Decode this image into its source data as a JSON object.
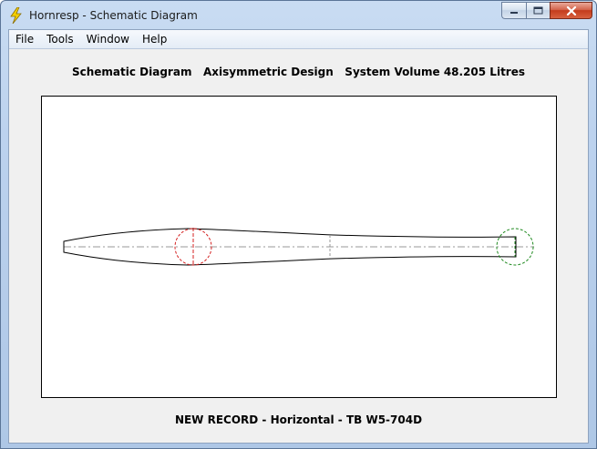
{
  "window": {
    "title": "Hornresp - Schematic Diagram",
    "icon": "lightning-bolt-icon",
    "controls": [
      "minimize-icon",
      "maximize-icon",
      "close-icon"
    ]
  },
  "menu": {
    "items": [
      {
        "label": "File"
      },
      {
        "label": "Tools"
      },
      {
        "label": "Window"
      },
      {
        "label": "Help"
      }
    ]
  },
  "header": {
    "text": "Schematic Diagram   Axisymmetric Design   System Volume 48.205 Litres"
  },
  "footer": {
    "text": "NEW RECORD - Horizontal - TB W5-704D"
  },
  "diagram": {
    "throat_marker_color": "#d42020",
    "mouth_marker_color": "#1f8a1f",
    "outline_color": "#000000",
    "axis_color": "#999999"
  }
}
